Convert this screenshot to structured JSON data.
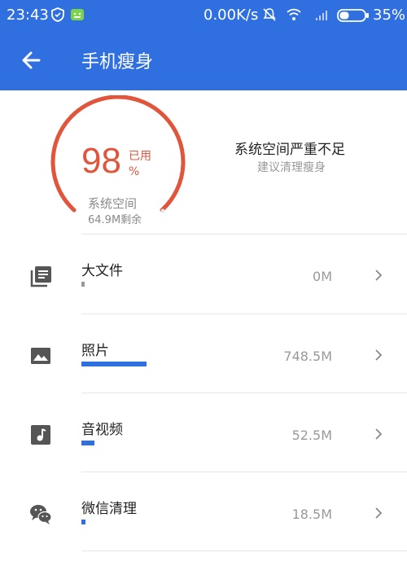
{
  "status_bar": {
    "time": "23:43",
    "net_speed": "0.00K/s",
    "battery_percent": "35%"
  },
  "app_bar": {
    "title": "手机瘦身"
  },
  "summary": {
    "percent": "98",
    "used_label": "已用",
    "unit": "%",
    "space_label": "系统空间",
    "free_text": "64.9M剩余",
    "warning_title": "系统空间严重不足",
    "warning_sub": "建议清理瘦身",
    "used_fraction": 0.98
  },
  "items": [
    {
      "label": "大文件",
      "size": "0M",
      "icon": "file-list-icon",
      "usage_fraction": 0.0
    },
    {
      "label": "照片",
      "size": "748.5M",
      "icon": "photo-icon",
      "usage_fraction": 0.8
    },
    {
      "label": "音视频",
      "size": "52.5M",
      "icon": "music-note-icon",
      "usage_fraction": 0.16
    },
    {
      "label": "微信清理",
      "size": "18.5M",
      "icon": "wechat-icon",
      "usage_fraction": 0.06
    }
  ],
  "colors": {
    "primary": "#2f6fe0",
    "accent_red": "#e2553d"
  }
}
